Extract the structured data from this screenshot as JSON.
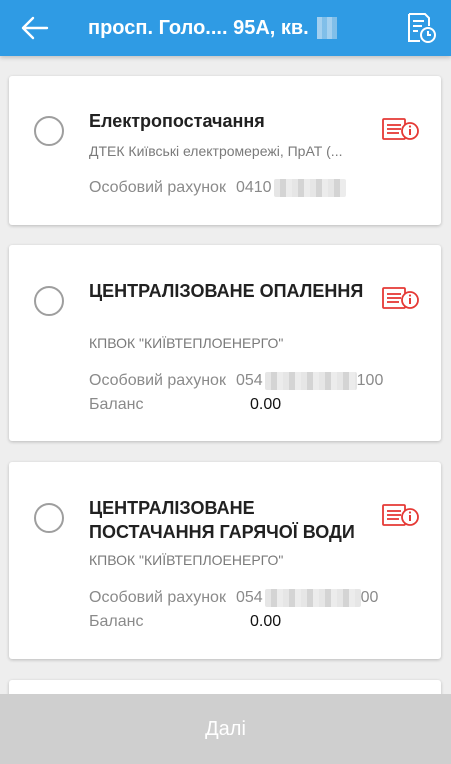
{
  "header": {
    "title": "просп. Голо.... 95А, кв.",
    "back_icon": "arrow-left-icon",
    "history_icon": "document-clock-icon"
  },
  "accounts": [
    {
      "name": "Електропостачання",
      "provider": "ДТЕК Київські електромережі, ПрАТ (...",
      "account_label": "Особовий рахунок",
      "account_prefix": "0410",
      "account_suffix": ""
    },
    {
      "name": "ЦЕНТРАЛІЗОВАНЕ ОПАЛЕННЯ",
      "provider": "КПВОК \"КИЇВТЕПЛОЕНЕРГО\"",
      "account_label": "Особовий рахунок",
      "account_prefix": "054",
      "account_suffix": "100",
      "balance_label": "Баланс",
      "balance_value": "0.00"
    },
    {
      "name": "ЦЕНТРАЛІЗОВАНЕ ПОСТАЧАННЯ ГАРЯЧОЇ ВОДИ",
      "provider": "КПВОК \"КИЇВТЕПЛОЕНЕРГО\"",
      "account_label": "Особовий рахунок",
      "account_prefix": "054",
      "account_suffix": "00",
      "balance_label": "Баланс",
      "balance_value": "0.00"
    }
  ],
  "footer": {
    "next_label": "Далі"
  },
  "colors": {
    "header": "#2f9be4",
    "icon_red": "#e53935",
    "footer_disabled": "#cfcfcf"
  }
}
